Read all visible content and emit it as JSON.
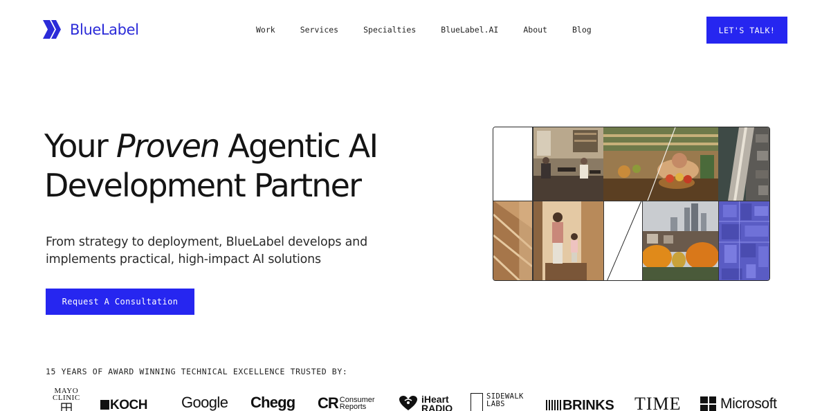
{
  "brand": {
    "name": "BlueLabel",
    "color": "#2b2bd8"
  },
  "nav": {
    "items": [
      {
        "label": "Work"
      },
      {
        "label": "Services"
      },
      {
        "label": "Specialties"
      },
      {
        "label": "BlueLabel.AI"
      },
      {
        "label": "About"
      },
      {
        "label": "Blog"
      }
    ],
    "cta_label": "LET'S TALK!"
  },
  "hero": {
    "title_pre": "Your ",
    "title_emphasis": "Proven",
    "title_post": " Agentic AI Development Partner",
    "subtitle": "From strategy to deployment, BlueLabel develops and implements practical, high-impact AI solutions",
    "cta_label": "Request A Consultation",
    "accent_color": "#2626f0"
  },
  "mosaic": {
    "tiles": [
      {
        "name": "blank-panel"
      },
      {
        "name": "cafe-interior-photo"
      },
      {
        "name": "market-shop-photo"
      },
      {
        "name": "aerial-road-photo"
      },
      {
        "name": "wood-corridor-photo"
      },
      {
        "name": "mother-child-doorway-photo"
      },
      {
        "name": "diagonal-line-panel"
      },
      {
        "name": "autumn-city-photo"
      },
      {
        "name": "blue-aerial-map-photo"
      }
    ]
  },
  "trusted": {
    "heading": "15 YEARS OF AWARD WINNING TECHNICAL EXCELLENCE TRUSTED BY:",
    "clients": {
      "mayo_line1": "MAYO",
      "mayo_line2": "CLINIC",
      "koch": "KOCH",
      "google": "Google",
      "chegg": "Chegg",
      "cr_mark": "CR",
      "cr_line1": "Consumer",
      "cr_line2": "Reports",
      "iheart_line1": "iHeart",
      "iheart_line2": "RADIO",
      "sidewalk_line1": "SIDEWALK",
      "sidewalk_line2": "LABS",
      "brinks": "BRINKS",
      "time": "TIME",
      "microsoft": "Microsoft"
    }
  }
}
